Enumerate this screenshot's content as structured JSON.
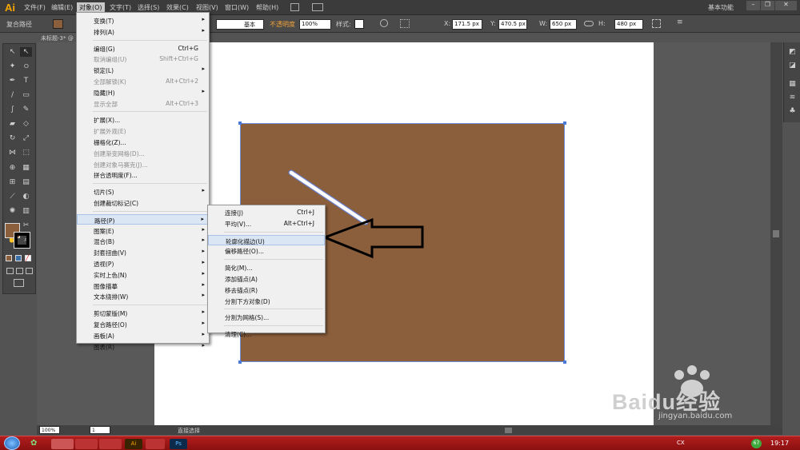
{
  "app": {
    "logo": "Ai",
    "workspace": "基本功能"
  },
  "menubar": [
    {
      "label": "文件(F)"
    },
    {
      "label": "编辑(E)"
    },
    {
      "label": "对象(O)"
    },
    {
      "label": "文字(T)"
    },
    {
      "label": "选择(S)"
    },
    {
      "label": "效果(C)"
    },
    {
      "label": "视图(V)"
    },
    {
      "label": "窗口(W)"
    },
    {
      "label": "帮助(H)"
    }
  ],
  "controlbar": {
    "selection_label": "复合路径",
    "stroke_style": "基本",
    "opacity_label": "不透明度",
    "opacity_value": "100%",
    "style_label": "样式:",
    "x_value": "171.5 px",
    "y_value": "470.5 px",
    "w_value": "650 px",
    "h_value": "480 px"
  },
  "doc_tab": "未标题-3* @",
  "object_menu": [
    {
      "label": "变换(T)",
      "submenu": true
    },
    {
      "label": "排列(A)",
      "submenu": true
    },
    {
      "sep": true
    },
    {
      "label": "编组(G)",
      "shortcut": "Ctrl+G"
    },
    {
      "label": "取消编组(U)",
      "shortcut": "Shift+Ctrl+G",
      "disabled": true
    },
    {
      "label": "锁定(L)",
      "submenu": true
    },
    {
      "label": "全部解锁(K)",
      "shortcut": "Alt+Ctrl+2",
      "disabled": true
    },
    {
      "label": "隐藏(H)",
      "submenu": true
    },
    {
      "label": "显示全部",
      "shortcut": "Alt+Ctrl+3",
      "disabled": true
    },
    {
      "sep": true
    },
    {
      "label": "扩展(X)..."
    },
    {
      "label": "扩展外观(E)",
      "disabled": true
    },
    {
      "label": "栅格化(Z)..."
    },
    {
      "label": "创建渐变网格(D)...",
      "disabled": true
    },
    {
      "label": "创建对象马赛克(J)...",
      "disabled": true
    },
    {
      "label": "拼合透明度(F)..."
    },
    {
      "sep": true
    },
    {
      "label": "切片(S)",
      "submenu": true
    },
    {
      "label": "创建裁切标记(C)"
    },
    {
      "sep": true
    },
    {
      "label": "路径(P)",
      "submenu": true,
      "highlighted": true
    },
    {
      "label": "图案(E)",
      "submenu": true
    },
    {
      "label": "混合(B)",
      "submenu": true
    },
    {
      "label": "封套扭曲(V)",
      "submenu": true
    },
    {
      "label": "透视(P)",
      "submenu": true
    },
    {
      "label": "实时上色(N)",
      "submenu": true
    },
    {
      "label": "图像描摹",
      "submenu": true
    },
    {
      "label": "文本绕排(W)",
      "submenu": true
    },
    {
      "sep": true
    },
    {
      "label": "剪切蒙版(M)",
      "submenu": true
    },
    {
      "label": "复合路径(O)",
      "submenu": true
    },
    {
      "label": "画板(A)",
      "submenu": true
    },
    {
      "label": "图表(R)",
      "submenu": true
    }
  ],
  "path_submenu": [
    {
      "label": "连接(J)",
      "shortcut": "Ctrl+J"
    },
    {
      "label": "平均(V)...",
      "shortcut": "Alt+Ctrl+J"
    },
    {
      "sep": true
    },
    {
      "label": "轮廓化描边(U)",
      "highlighted": true
    },
    {
      "label": "偏移路径(O)..."
    },
    {
      "sep": true
    },
    {
      "label": "简化(M)..."
    },
    {
      "label": "添加锚点(A)"
    },
    {
      "label": "移去锚点(R)"
    },
    {
      "label": "分割下方对象(D)"
    },
    {
      "sep": true
    },
    {
      "label": "分割为网格(S)..."
    },
    {
      "sep": true
    },
    {
      "label": "清理(C)..."
    }
  ],
  "statusbar": {
    "zoom": "100%",
    "page": "1",
    "tool": "直接选择"
  },
  "taskbar": {
    "lang": "CX",
    "badge": "67",
    "time": "19:17"
  },
  "watermark": {
    "text": "Baidu经验",
    "url": "jingyan.baidu.com"
  },
  "colors": {
    "fill": "#8b5e3c",
    "accent": "#f7a600",
    "menu_highlight": "#dbe6f4"
  }
}
